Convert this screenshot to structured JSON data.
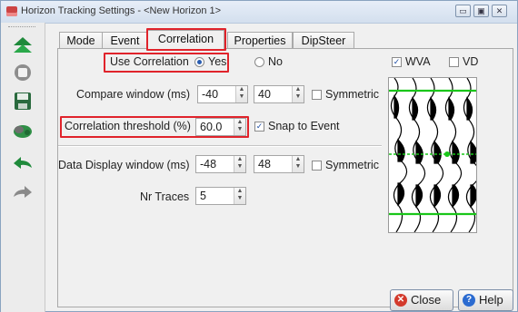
{
  "window": {
    "title": "Horizon Tracking Settings - <New Horizon 1>",
    "controls": {
      "minimize": "▭",
      "maximize": "▣",
      "close": "✕"
    }
  },
  "toolbar": {
    "icons": [
      "arrows-up-icon",
      "stop-icon",
      "save-icon",
      "retrack-icon",
      "undo-icon",
      "redo-icon"
    ]
  },
  "tabs": [
    {
      "label": "Mode",
      "active": false
    },
    {
      "label": "Event",
      "active": false
    },
    {
      "label": "Correlation",
      "active": true
    },
    {
      "label": "Properties",
      "active": false
    },
    {
      "label": "DipSteer",
      "active": false
    }
  ],
  "correlation": {
    "use_label": "Use Correlation",
    "yes_label": "Yes",
    "no_label": "No",
    "use_selected": "Yes",
    "compare_label": "Compare window (ms)",
    "compare_from": "-40",
    "compare_to": "40",
    "symmetric_label": "Symmetric",
    "compare_symmetric": false,
    "threshold_label": "Correlation threshold (%)",
    "threshold_value": "60.0",
    "snap_label": "Snap to Event",
    "snap_checked": true,
    "display_label": "Data Display window (ms)",
    "display_from": "-48",
    "display_to": "48",
    "display_symmetric": false,
    "nr_traces_label": "Nr Traces",
    "nr_traces_value": "5"
  },
  "preview": {
    "wva_label": "WVA",
    "wva_checked": true,
    "vd_label": "VD",
    "vd_checked": false
  },
  "buttons": {
    "close": "Close",
    "help": "Help"
  },
  "colors": {
    "highlight": "#e0232b",
    "horizon": "#19c619",
    "close_icon": "#d33a2c",
    "help_icon": "#2b6bd0"
  }
}
